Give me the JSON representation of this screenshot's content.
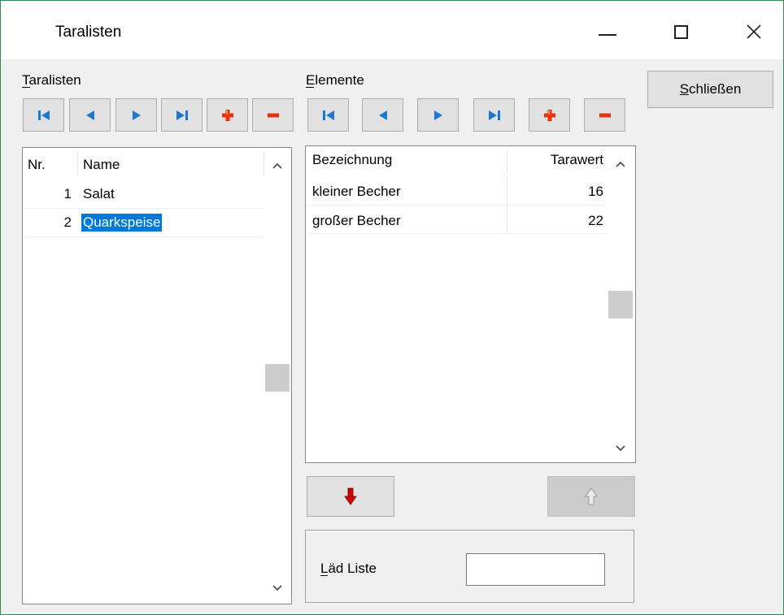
{
  "window": {
    "title": "Taralisten",
    "minimize_icon": "minimize-icon",
    "maximize_icon": "maximize-icon",
    "close_icon": "close-icon"
  },
  "close_button": {
    "label": "Schließen",
    "mnemonic": "S"
  },
  "taralisten": {
    "label": "Taralisten",
    "mnemonic": "T",
    "toolbar": [
      "first-record-icon",
      "previous-record-icon",
      "next-record-icon",
      "last-record-icon",
      "add-record-icon",
      "delete-record-icon"
    ],
    "columns": [
      "Nr.",
      "Name"
    ],
    "rows": [
      {
        "nr": "1",
        "name": "Salat"
      },
      {
        "nr": "2",
        "name": "Quarkspeise"
      }
    ],
    "selected_row": 1
  },
  "elemente": {
    "label": "Elemente",
    "mnemonic": "E",
    "toolbar": [
      "first-record-icon",
      "previous-record-icon",
      "next-record-icon",
      "last-record-icon",
      "add-record-icon",
      "delete-record-icon"
    ],
    "columns": [
      "Bezeichnung",
      "Tarawert"
    ],
    "rows": [
      {
        "bezeichnung": "kleiner Becher",
        "tarawert": "16"
      },
      {
        "bezeichnung": "großer Becher",
        "tarawert": "22"
      }
    ]
  },
  "transfer": {
    "down_icon": "arrow-down-icon",
    "up_icon": "arrow-up-icon",
    "down_color": "#d40000",
    "up_enabled": false
  },
  "lade": {
    "label": "Läd Liste",
    "mnemonic": "L",
    "value": ""
  },
  "colors": {
    "nav_blue": "#1e78d2",
    "add_delete_red": "#e8330a",
    "selection": "#0078d7",
    "window_border": "#2e8b57"
  }
}
